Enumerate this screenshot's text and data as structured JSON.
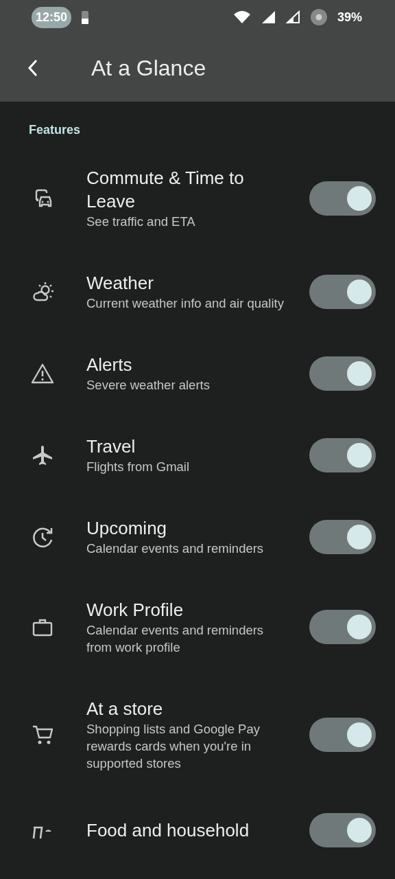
{
  "status_bar": {
    "time": "12:50",
    "battery": "39%"
  },
  "app_bar": {
    "title": "At a Glance"
  },
  "features": {
    "header": "Features",
    "items": [
      {
        "title": "Commute & Time to Leave",
        "subtitle": "See traffic and ETA",
        "on": true
      },
      {
        "title": "Weather",
        "subtitle": "Current weather info and air quality",
        "on": true
      },
      {
        "title": "Alerts",
        "subtitle": "Severe weather alerts",
        "on": true
      },
      {
        "title": "Travel",
        "subtitle": "Flights from Gmail",
        "on": true
      },
      {
        "title": "Upcoming",
        "subtitle": "Calendar events and reminders",
        "on": true
      },
      {
        "title": "Work Profile",
        "subtitle": "Calendar events and reminders from work profile",
        "on": true
      },
      {
        "title": "At a store",
        "subtitle": "Shopping lists and Google Pay rewards cards when you're in supported stores",
        "on": true
      },
      {
        "title": "Food and household",
        "on": true
      }
    ]
  }
}
